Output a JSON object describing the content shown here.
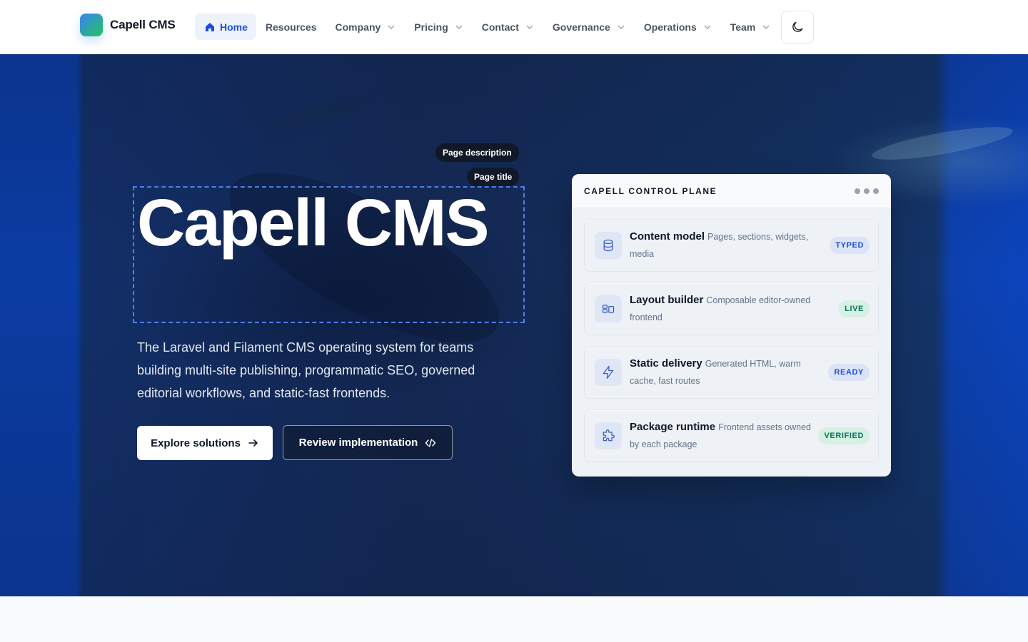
{
  "brand": {
    "name": "Capell CMS"
  },
  "nav": {
    "items": [
      {
        "label": "Home",
        "active": true,
        "icon": "home-icon",
        "dropdown": false
      },
      {
        "label": "Resources",
        "dropdown": false
      },
      {
        "label": "Company",
        "dropdown": true
      },
      {
        "label": "Pricing",
        "dropdown": true
      },
      {
        "label": "Contact",
        "dropdown": true
      },
      {
        "label": "Governance",
        "dropdown": true
      },
      {
        "label": "Operations",
        "dropdown": true
      },
      {
        "label": "Team",
        "dropdown": true
      }
    ],
    "theme_toggle_icon": "moon-icon"
  },
  "hero": {
    "chips": {
      "description": "Page description",
      "title": "Page title"
    },
    "title": "Capell CMS",
    "description": "The Laravel and Filament CMS operating system for teams building multi-site publishing, programmatic SEO, governed editorial workflows, and static-fast frontends.",
    "primary_button": "Explore solutions",
    "secondary_button": "Review implementation"
  },
  "panel": {
    "title": "CAPELL CONTROL PLANE",
    "rows": [
      {
        "name": "Content model",
        "desc": "Pages, sections, widgets, media",
        "badge": "TYPED",
        "badge_color": "blue",
        "icon": "database-icon"
      },
      {
        "name": "Layout builder",
        "desc": "Composable editor-owned frontend",
        "badge": "LIVE",
        "badge_color": "green",
        "icon": "layout-icon"
      },
      {
        "name": "Static delivery",
        "desc": "Generated HTML, warm cache, fast routes",
        "badge": "READY",
        "badge_color": "blue",
        "icon": "lightning-icon"
      },
      {
        "name": "Package runtime",
        "desc": "Frontend assets owned by each package",
        "badge": "VERIFIED",
        "badge_color": "green",
        "icon": "puzzle-icon"
      }
    ]
  },
  "colors": {
    "accent": "#1d4ed8",
    "hero_bg": "#152a55",
    "badge_green": "#047857"
  }
}
